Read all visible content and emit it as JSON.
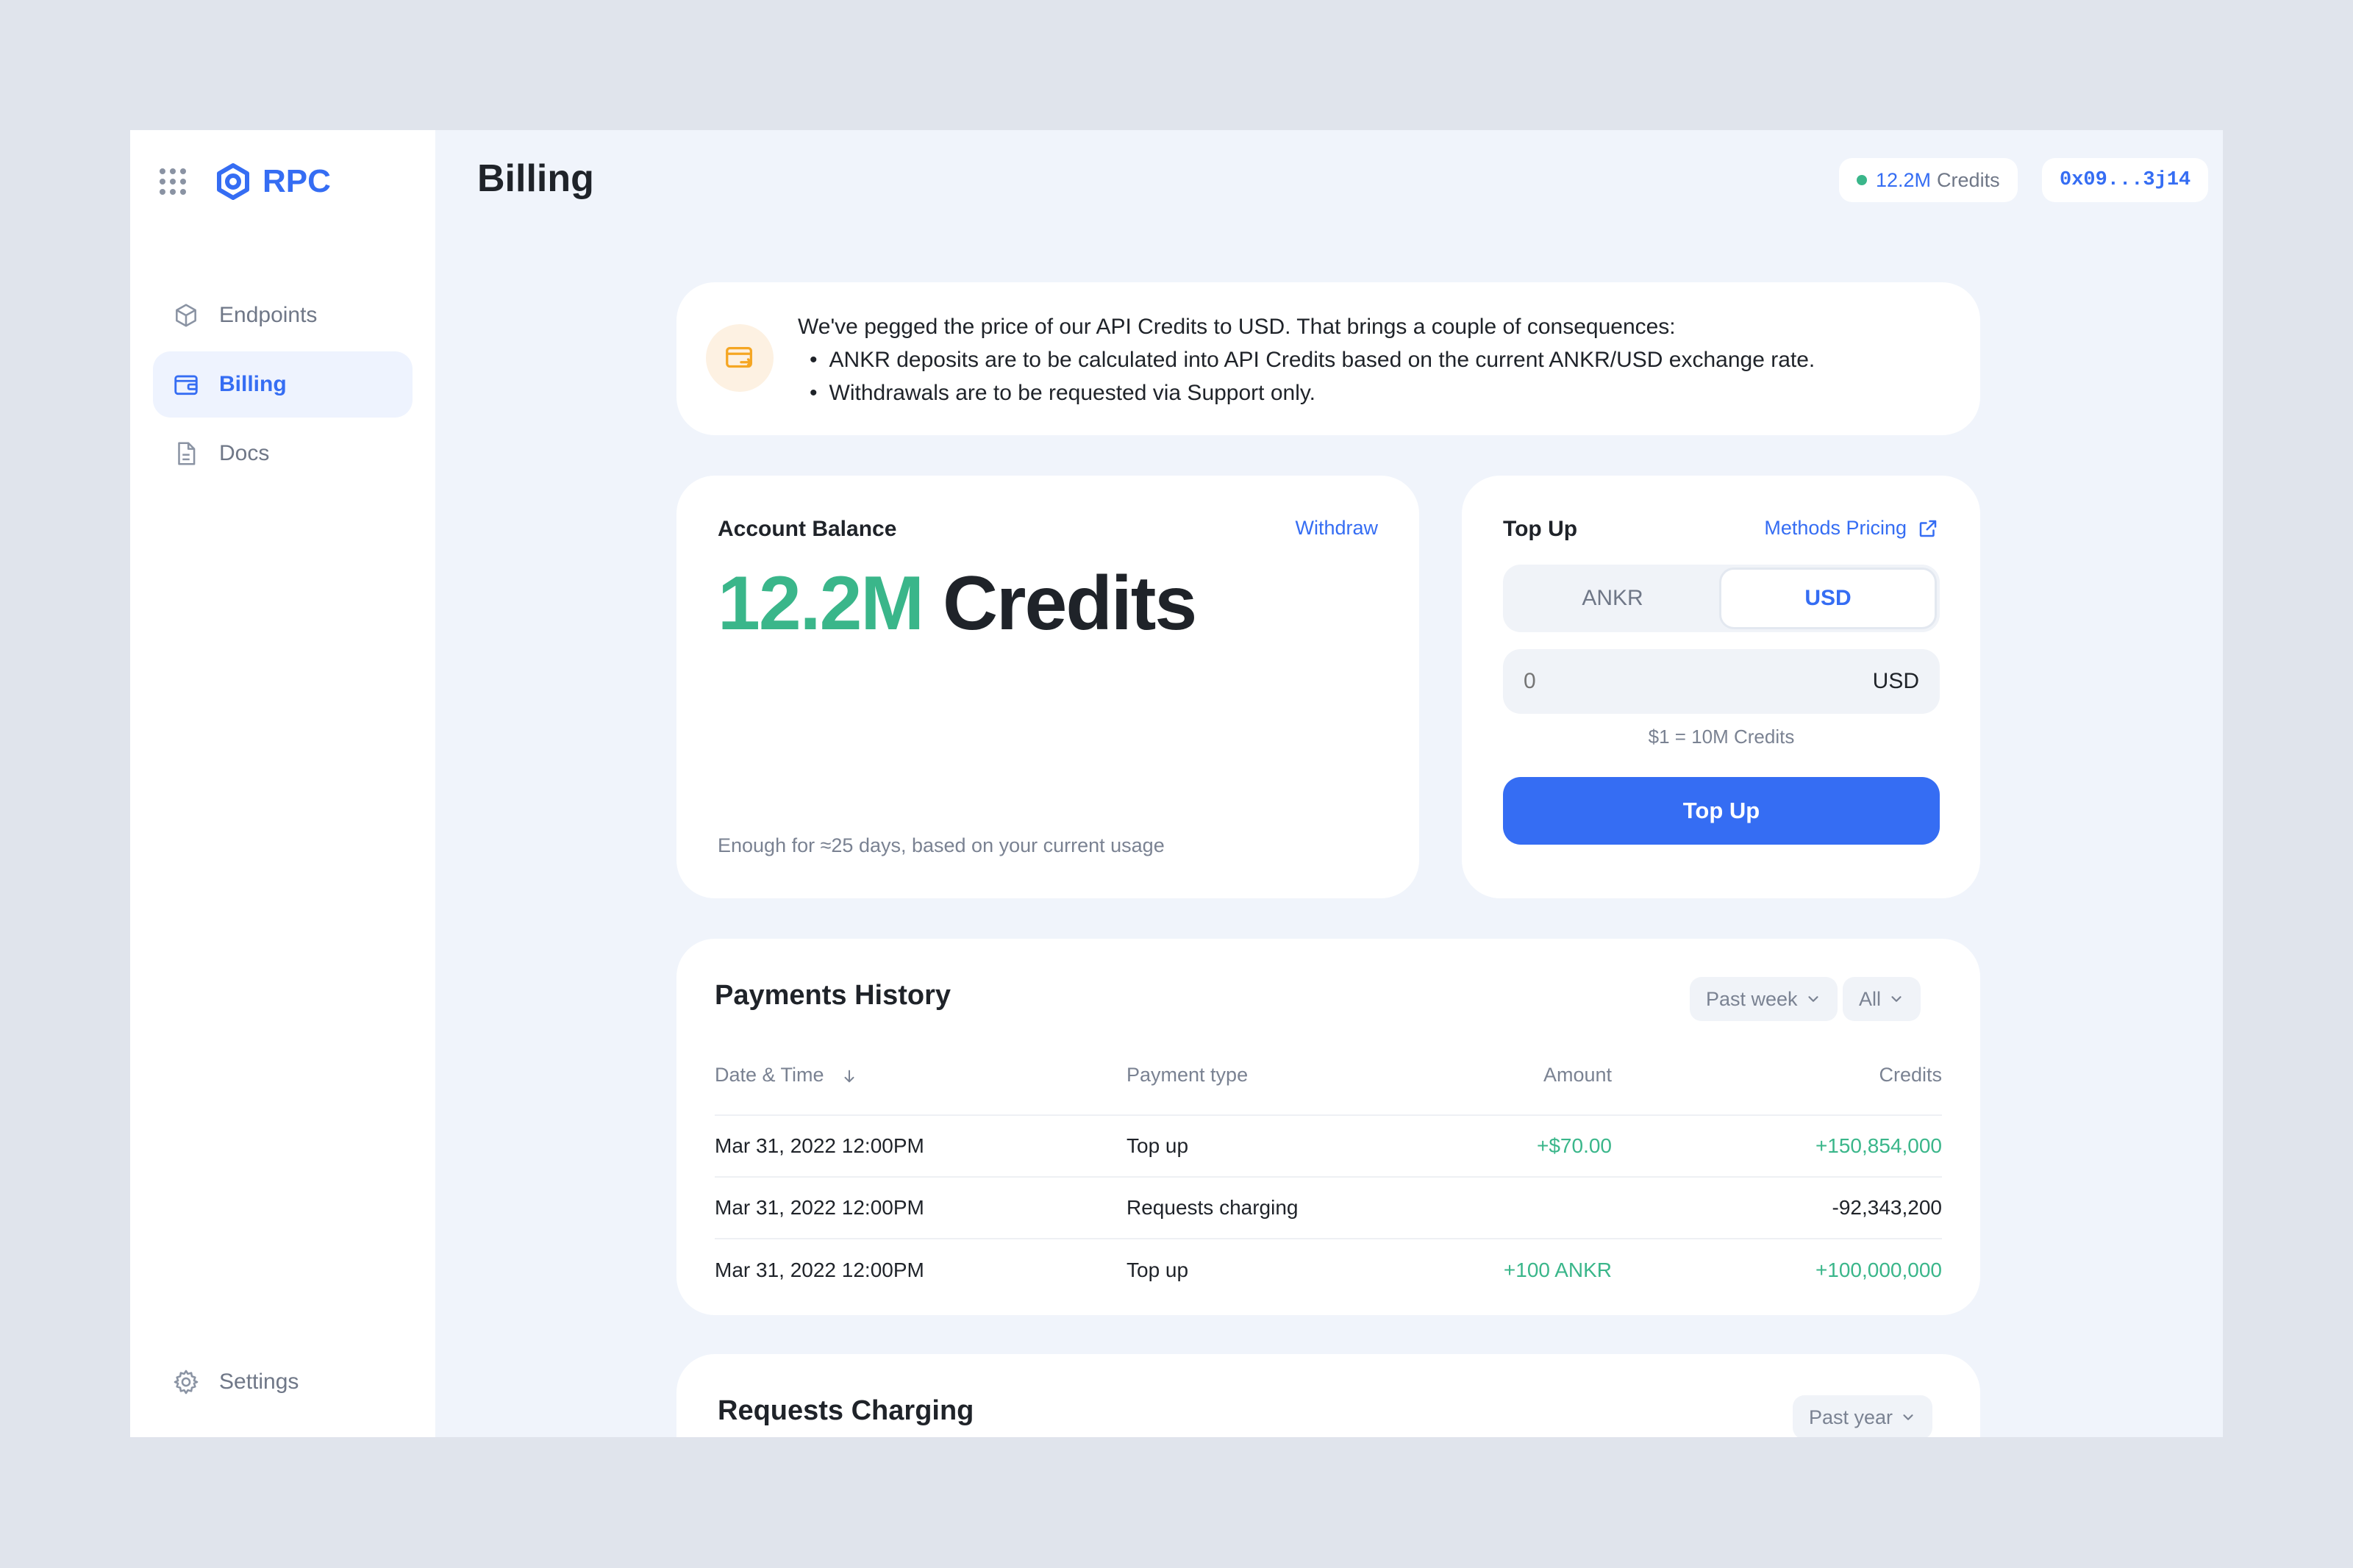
{
  "sidebar": {
    "logo": "RPC",
    "items": [
      {
        "label": "Endpoints",
        "icon": "cube-icon"
      },
      {
        "label": "Billing",
        "icon": "wallet-icon"
      },
      {
        "label": "Docs",
        "icon": "document-icon"
      }
    ],
    "settings": {
      "label": "Settings",
      "icon": "gear-icon"
    }
  },
  "header": {
    "title": "Billing",
    "credits_amount": "12.2M",
    "credits_label": "Credits",
    "address": "0x09...3j14"
  },
  "notice": {
    "intro": "We've pegged the price of our API Credits to USD. That brings a couple of consequences:",
    "bullets": [
      "ANKR deposits are to be calculated into API Credits based on the current ANKR/USD exchange rate.",
      "Withdrawals are to be requested via Support only."
    ]
  },
  "balance": {
    "label": "Account Balance",
    "withdraw": "Withdraw",
    "amount": "12.2M",
    "unit": "Credits",
    "hint": "Enough for ≈25 days, based on your current usage"
  },
  "topup": {
    "label": "Top Up",
    "pricing_link": "Methods Pricing",
    "options": [
      "ANKR",
      "USD"
    ],
    "selected": "USD",
    "input_placeholder": "0",
    "currency": "USD",
    "rate": "$1 = 10M Credits",
    "button": "Top Up"
  },
  "history": {
    "title": "Payments History",
    "period_filter": "Past week",
    "type_filter": "All",
    "columns": [
      "Date & Time",
      "Payment type",
      "Amount",
      "Credits"
    ],
    "rows": [
      {
        "date": "Mar 31, 2022 12:00PM",
        "type": "Top up",
        "amount": "+$70.00",
        "credits": "+150,854,000"
      },
      {
        "date": "Mar 31, 2022 12:00PM",
        "type": "Requests charging",
        "amount": "",
        "credits": "-92,343,200"
      },
      {
        "date": "Mar 31, 2022 12:00PM",
        "type": "Top up",
        "amount": "+100 ANKR",
        "credits": "+100,000,000"
      }
    ]
  },
  "charging": {
    "title": "Requests Charging",
    "period_filter": "Past year"
  },
  "colors": {
    "accent": "#356df3",
    "positive": "#3ab68a",
    "background": "#f0f4fb"
  }
}
